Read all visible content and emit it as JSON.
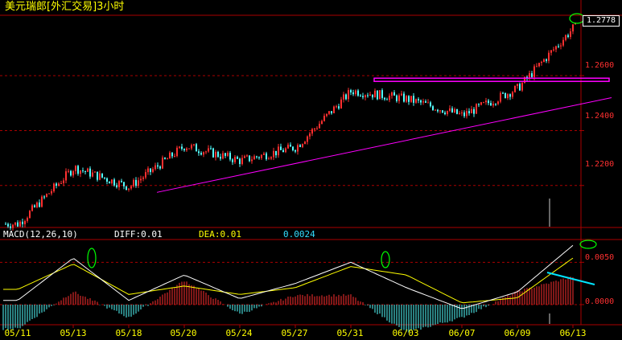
{
  "title": "美元瑞郎[外汇交易]3小时",
  "price_axis": {
    "labels": [
      "1.2600",
      "1.2400",
      "1.2200"
    ],
    "last_price": "1.2778"
  },
  "macd_panel": {
    "name": "MACD(12,26,10)",
    "diff": "DIFF:0.01",
    "dea": "DEA:0.01",
    "value": "0.0024",
    "axis_labels": [
      "0.0050",
      "0.0000"
    ]
  },
  "date_axis": [
    "05/11",
    "05/13",
    "05/18",
    "05/20",
    "05/24",
    "05/27",
    "05/31",
    "06/03",
    "06/07",
    "06/09",
    "06/13"
  ],
  "colors": {
    "background": "#000000",
    "up_candle": "#ff3030",
    "down_candle": "#54ffff",
    "trendline": "#ff00ff",
    "macd_diff": "#ffffff",
    "macd_dea": "#ffff00",
    "grid": "#aa0000",
    "annotation_circle": "#00ff00",
    "annotation_line": "#00e5ff"
  },
  "chart_data": [
    {
      "type": "candlestick",
      "series": [
        {
          "name": "美元瑞郎",
          "timeframe": "3小时"
        }
      ],
      "x_ticks": [
        "05/11",
        "05/13",
        "05/18",
        "05/20",
        "05/24",
        "05/27",
        "05/31",
        "06/03",
        "06/07",
        "06/09",
        "06/13"
      ],
      "y_ticks": [
        1.22,
        1.24,
        1.26
      ],
      "ylim": [
        1.205,
        1.282
      ],
      "last_value": 1.2778,
      "grid": true,
      "close_path": [
        [
          "05/11",
          1.206
        ],
        [
          "05/13",
          1.2265
        ],
        [
          "05/18",
          1.2195
        ],
        [
          "05/20",
          1.2345
        ],
        [
          "05/24",
          1.229
        ],
        [
          "05/27",
          1.234
        ],
        [
          "05/31",
          1.2545
        ],
        [
          "06/03",
          1.2515
        ],
        [
          "06/07",
          1.2455
        ],
        [
          "06/09",
          1.2555
        ],
        [
          "06/13",
          1.2775
        ]
      ],
      "trendlines": [
        {
          "from": [
            "05/18",
            1.2175
          ],
          "to": [
            "06/13",
            1.2512
          ],
          "label": ""
        },
        {
          "from": [
            "05/31",
            1.2585
          ],
          "to": [
            "06/13",
            1.2585
          ],
          "label": ""
        }
      ]
    },
    {
      "type": "macd",
      "params": [
        12,
        26,
        10
      ],
      "diff": 0.01,
      "dea": 0.01,
      "macd": 0.0024,
      "y_ticks": [
        0.0,
        0.005
      ],
      "ylim": [
        -0.002,
        0.0075
      ],
      "diff_path": [
        [
          "05/11",
          0.0005
        ],
        [
          "05/13",
          0.0055
        ],
        [
          "05/18",
          0.0005
        ],
        [
          "05/20",
          0.0035
        ],
        [
          "05/24",
          0.0007
        ],
        [
          "05/27",
          0.0025
        ],
        [
          "05/31",
          0.005
        ],
        [
          "06/03",
          0.002
        ],
        [
          "06/07",
          -0.0005
        ],
        [
          "06/09",
          0.0015
        ],
        [
          "06/13",
          0.007
        ]
      ],
      "dea_path": [
        [
          "05/11",
          0.0018
        ],
        [
          "05/13",
          0.0048
        ],
        [
          "05/18",
          0.0012
        ],
        [
          "05/20",
          0.0022
        ],
        [
          "05/24",
          0.0012
        ],
        [
          "05/27",
          0.002
        ],
        [
          "05/31",
          0.0045
        ],
        [
          "06/03",
          0.0035
        ],
        [
          "06/07",
          0.0002
        ],
        [
          "06/09",
          0.0008
        ],
        [
          "06/13",
          0.0055
        ]
      ]
    }
  ]
}
